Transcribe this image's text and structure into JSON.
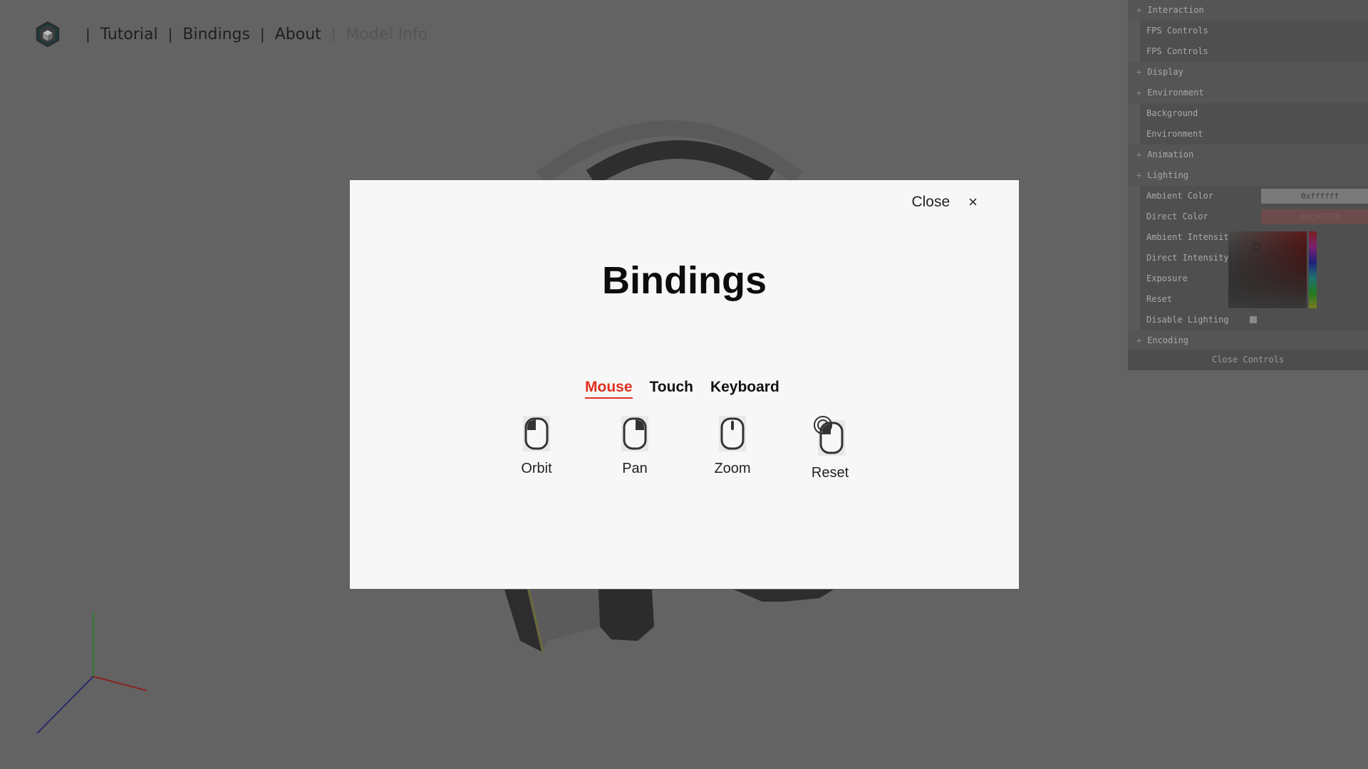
{
  "nav": {
    "items": [
      {
        "label": "Tutorial"
      },
      {
        "label": "Bindings"
      },
      {
        "label": "About"
      },
      {
        "label": "Model Info"
      }
    ],
    "separator": "|"
  },
  "panel": {
    "rows": [
      {
        "type": "folder",
        "label": "Interaction"
      },
      {
        "type": "item",
        "label": "FPS Controls"
      },
      {
        "type": "item",
        "label": "FPS Controls"
      },
      {
        "type": "folder",
        "label": "Display"
      },
      {
        "type": "folder",
        "label": "Environment"
      },
      {
        "type": "item",
        "label": "Background"
      },
      {
        "type": "item",
        "label": "Environment"
      },
      {
        "type": "folder",
        "label": "Animation"
      },
      {
        "type": "folder",
        "label": "Lighting"
      },
      {
        "type": "item",
        "label": "Ambient Color",
        "value": "0xffffff"
      },
      {
        "type": "item",
        "label": "Direct Color",
        "value": "0xc97878"
      },
      {
        "type": "item",
        "label": "Ambient Intensity"
      },
      {
        "type": "item",
        "label": "Direct Intensity"
      },
      {
        "type": "item",
        "label": "Exposure"
      },
      {
        "type": "item",
        "label": "Reset"
      },
      {
        "type": "item",
        "label": "Disable Lighting"
      },
      {
        "type": "folder",
        "label": "Encoding"
      }
    ],
    "close_label": "Close Controls",
    "ambient_color": "#ffffff",
    "direct_color": "#c97878"
  },
  "modal": {
    "close_label": "Close",
    "close_icon": "×",
    "title": "Bindings",
    "tabs": [
      {
        "label": "Mouse",
        "active": true
      },
      {
        "label": "Touch",
        "active": false
      },
      {
        "label": "Keyboard",
        "active": false
      }
    ],
    "bindings": [
      {
        "label": "Orbit",
        "icon": "mouse-left-icon"
      },
      {
        "label": "Pan",
        "icon": "mouse-right-icon"
      },
      {
        "label": "Zoom",
        "icon": "mouse-wheel-icon"
      },
      {
        "label": "Reset",
        "icon": "mouse-double-click-icon"
      }
    ]
  },
  "colors": {
    "accent": "#e0301e",
    "backdrop": "#636363",
    "modal_bg": "#f7f7f7"
  }
}
